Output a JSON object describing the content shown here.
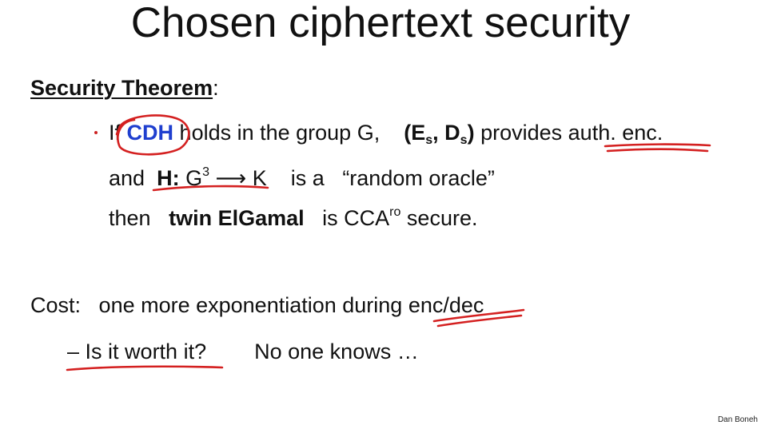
{
  "title": "Chosen ciphertext security",
  "theorem": {
    "heading": "Security Theorem",
    "colon": ":",
    "line1": {
      "if": "If",
      "cdh": "CDH",
      "holds": "holds in the group G,",
      "es_open": "(E",
      "es_sub": "s",
      "comma": ", D",
      "ds_sub": "s",
      "close": ")",
      "provides": "provides",
      "auth_enc": "auth. enc."
    },
    "line2": {
      "and": "and",
      "h": "H:",
      "g": "G",
      "g_sup": "3",
      "arrow_k": "⟶ K",
      "is_a": "is a",
      "random_oracle": "“random oracle”"
    },
    "line3": {
      "then": "then",
      "scheme": "twin ElGamal",
      "is": "is",
      "cca": "CCA",
      "cca_sup": "ro",
      "secure": "secure."
    }
  },
  "cost": {
    "label": "Cost:",
    "text": "one more exponentiation during",
    "enc_dec": "enc/dec"
  },
  "bullet": {
    "dash": "–",
    "question": "Is it worth it?",
    "answer": "No one knows …"
  },
  "credit": "Dan Boneh",
  "colors": {
    "highlight_blue": "#1f3fcf",
    "annotation_red": "#d42020"
  }
}
